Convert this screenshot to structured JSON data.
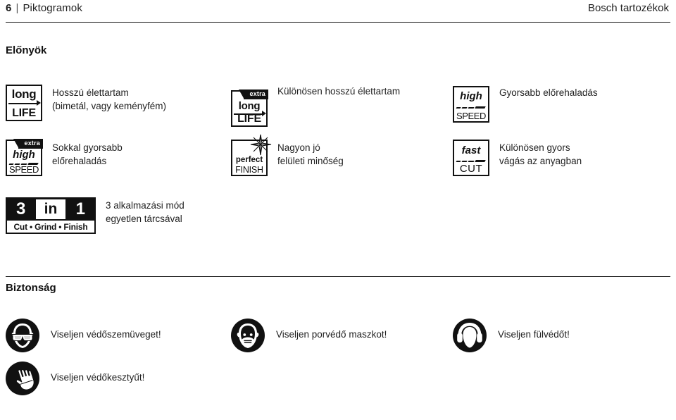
{
  "header": {
    "page_number": "6",
    "separator": "|",
    "chapter": "Piktogramok",
    "brand": "Bosch tartozékok"
  },
  "sections": {
    "advantages": {
      "title": "Előnyök"
    },
    "safety": {
      "title": "Biztonság"
    }
  },
  "advantages": [
    {
      "icon": "long-life-icon",
      "badge": {
        "top": "long",
        "bottom": "LIFE",
        "ribbon": ""
      },
      "text": "Hosszú élettartam\n(bimetál, vagy keményfém)"
    },
    {
      "icon": "extra-long-life-icon",
      "badge": {
        "top": "long",
        "bottom": "LIFE",
        "ribbon": "extra"
      },
      "text": "Különösen hosszú élettartam"
    },
    {
      "icon": "high-speed-icon",
      "badge": {
        "top": "high",
        "bottom": "SPEED",
        "ribbon": ""
      },
      "text": "Gyorsabb előrehaladás"
    },
    {
      "icon": "extra-high-speed-icon",
      "badge": {
        "top": "high",
        "bottom": "SPEED",
        "ribbon": "extra"
      },
      "text": "Sokkal gyorsabb\nelőrehaladás"
    },
    {
      "icon": "perfect-finish-icon",
      "badge": {
        "top": "perfect",
        "bottom": "FINISH",
        "ribbon": ""
      },
      "text": "Nagyon jó\nfelületi minőség"
    },
    {
      "icon": "fast-cut-icon",
      "badge": {
        "top": "fast",
        "bottom": "CUT",
        "ribbon": ""
      },
      "text": "Különösen gyors\nvágás az anyagban"
    },
    {
      "icon": "three-in-one-icon",
      "badge": {
        "num1": "3",
        "mid": "in",
        "num2": "1",
        "bottom": "Cut • Grind • Finish"
      },
      "text": "3 alkalmazási mód\negyetlen tárcsával"
    }
  ],
  "safety": [
    {
      "icon": "safety-goggles-icon",
      "text": "Viseljen védőszemüveget!"
    },
    {
      "icon": "dust-mask-icon",
      "text": "Viseljen porvédő maszkot!"
    },
    {
      "icon": "ear-protection-icon",
      "text": "Viseljen fülvédőt!"
    },
    {
      "icon": "safety-gloves-icon",
      "text": "Viseljen védőkesztyűt!"
    }
  ],
  "colors": {
    "ink": "#111111",
    "text": "#1f1f1f",
    "paper": "#ffffff"
  }
}
